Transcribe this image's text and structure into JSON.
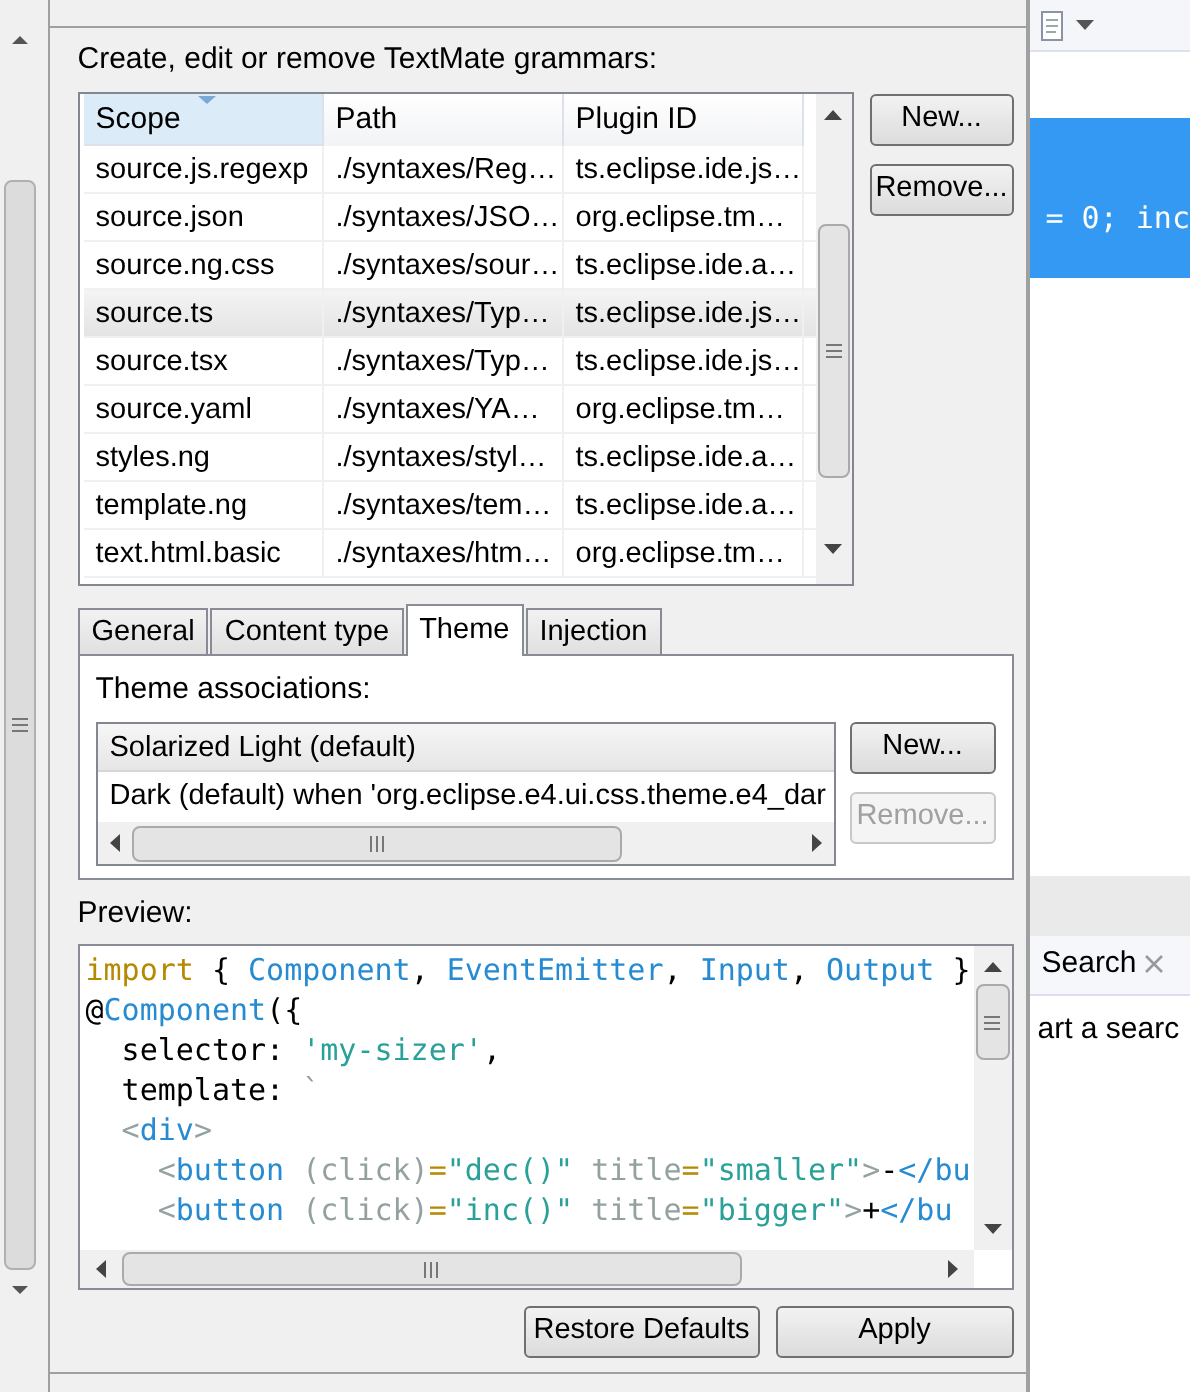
{
  "dialog": {
    "description": "Create, edit or remove TextMate grammars:",
    "grammars_table": {
      "columns": [
        {
          "label": "Scope",
          "sorted": true
        },
        {
          "label": "Path",
          "sorted": false
        },
        {
          "label": "Plugin ID",
          "sorted": false
        }
      ],
      "rows": [
        {
          "scope": "source.js.regexp",
          "path": "./syntaxes/Reg…",
          "plugin_id": "ts.eclipse.ide.js…",
          "selected": false
        },
        {
          "scope": "source.json",
          "path": "./syntaxes/JSO…",
          "plugin_id": "org.eclipse.tm…",
          "selected": false
        },
        {
          "scope": "source.ng.css",
          "path": "./syntaxes/sour…",
          "plugin_id": "ts.eclipse.ide.a…",
          "selected": false
        },
        {
          "scope": "source.ts",
          "path": "./syntaxes/Typ…",
          "plugin_id": "ts.eclipse.ide.js…",
          "selected": true
        },
        {
          "scope": "source.tsx",
          "path": "./syntaxes/Typ…",
          "plugin_id": "ts.eclipse.ide.js…",
          "selected": false
        },
        {
          "scope": "source.yaml",
          "path": "./syntaxes/YA…",
          "plugin_id": "org.eclipse.tm…",
          "selected": false
        },
        {
          "scope": "styles.ng",
          "path": "./syntaxes/styl…",
          "plugin_id": "ts.eclipse.ide.a…",
          "selected": false
        },
        {
          "scope": "template.ng",
          "path": "./syntaxes/tem…",
          "plugin_id": "ts.eclipse.ide.a…",
          "selected": false
        },
        {
          "scope": "text.html.basic",
          "path": "./syntaxes/htm…",
          "plugin_id": "org.eclipse.tm…",
          "selected": false
        }
      ]
    },
    "table_buttons": [
      "New...",
      "Remove..."
    ],
    "tabs": [
      {
        "label": "General",
        "selected": false
      },
      {
        "label": "Content type",
        "selected": false
      },
      {
        "label": "Theme",
        "selected": true
      },
      {
        "label": "Injection",
        "selected": false
      }
    ],
    "theme_associations": {
      "label": "Theme associations:",
      "items": [
        {
          "text": "Solarized Light (default)",
          "selected": true
        },
        {
          "text": "Dark (default) when 'org.eclipse.e4.ui.css.theme.e4_dar",
          "selected": false
        }
      ],
      "buttons": [
        {
          "label": "New...",
          "disabled": false
        },
        {
          "label": "Remove...",
          "disabled": true
        }
      ]
    },
    "preview": {
      "label": "Preview:",
      "lines": [
        {
          "tokens": [
            {
              "text": "import",
              "kind": "keyword"
            },
            {
              "text": " { ",
              "kind": "plain"
            },
            {
              "text": "Component",
              "kind": "type"
            },
            {
              "text": ", ",
              "kind": "plain"
            },
            {
              "text": "EventEmitter",
              "kind": "type"
            },
            {
              "text": ", ",
              "kind": "plain"
            },
            {
              "text": "Input",
              "kind": "type"
            },
            {
              "text": ", ",
              "kind": "plain"
            },
            {
              "text": "Output",
              "kind": "type"
            },
            {
              "text": " }",
              "kind": "plain"
            }
          ]
        },
        {
          "tokens": [
            {
              "text": "@",
              "kind": "plain"
            },
            {
              "text": "Component",
              "kind": "type"
            },
            {
              "text": "({",
              "kind": "plain"
            }
          ]
        },
        {
          "tokens": [
            {
              "text": "  selector: ",
              "kind": "plain"
            },
            {
              "text": "'my-sizer'",
              "kind": "string"
            },
            {
              "text": ",",
              "kind": "plain"
            }
          ]
        },
        {
          "tokens": [
            {
              "text": "  template: ",
              "kind": "plain"
            },
            {
              "text": "`",
              "kind": "punct"
            }
          ]
        },
        {
          "tokens": [
            {
              "text": "  <",
              "kind": "punct"
            },
            {
              "text": "div",
              "kind": "type"
            },
            {
              "text": ">",
              "kind": "punct"
            }
          ]
        },
        {
          "tokens": [
            {
              "text": "    <",
              "kind": "punct"
            },
            {
              "text": "button",
              "kind": "type"
            },
            {
              "text": " (click)",
              "kind": "punct"
            },
            {
              "text": "=",
              "kind": "op"
            },
            {
              "text": "\"dec()\"",
              "kind": "string"
            },
            {
              "text": " title",
              "kind": "punct"
            },
            {
              "text": "=",
              "kind": "op"
            },
            {
              "text": "\"smaller\"",
              "kind": "string"
            },
            {
              "text": ">",
              "kind": "punct"
            },
            {
              "text": "-",
              "kind": "plain"
            },
            {
              "text": "</bu",
              "kind": "type"
            }
          ]
        },
        {
          "tokens": [
            {
              "text": "    <",
              "kind": "punct"
            },
            {
              "text": "button",
              "kind": "type"
            },
            {
              "text": " (click)",
              "kind": "punct"
            },
            {
              "text": "=",
              "kind": "op"
            },
            {
              "text": "\"inc()\"",
              "kind": "string"
            },
            {
              "text": " title",
              "kind": "punct"
            },
            {
              "text": "=",
              "kind": "op"
            },
            {
              "text": "\"bigger\"",
              "kind": "string"
            },
            {
              "text": ">",
              "kind": "punct"
            },
            {
              "text": "+",
              "kind": "plain"
            },
            {
              "text": "</bu",
              "kind": "type"
            }
          ]
        }
      ]
    },
    "buttons": [
      "Restore Defaults",
      "Apply"
    ]
  },
  "editor": {
    "selection_text": "= 0; inc"
  },
  "search_view": {
    "tab": "Search",
    "message": "art a searc"
  }
}
